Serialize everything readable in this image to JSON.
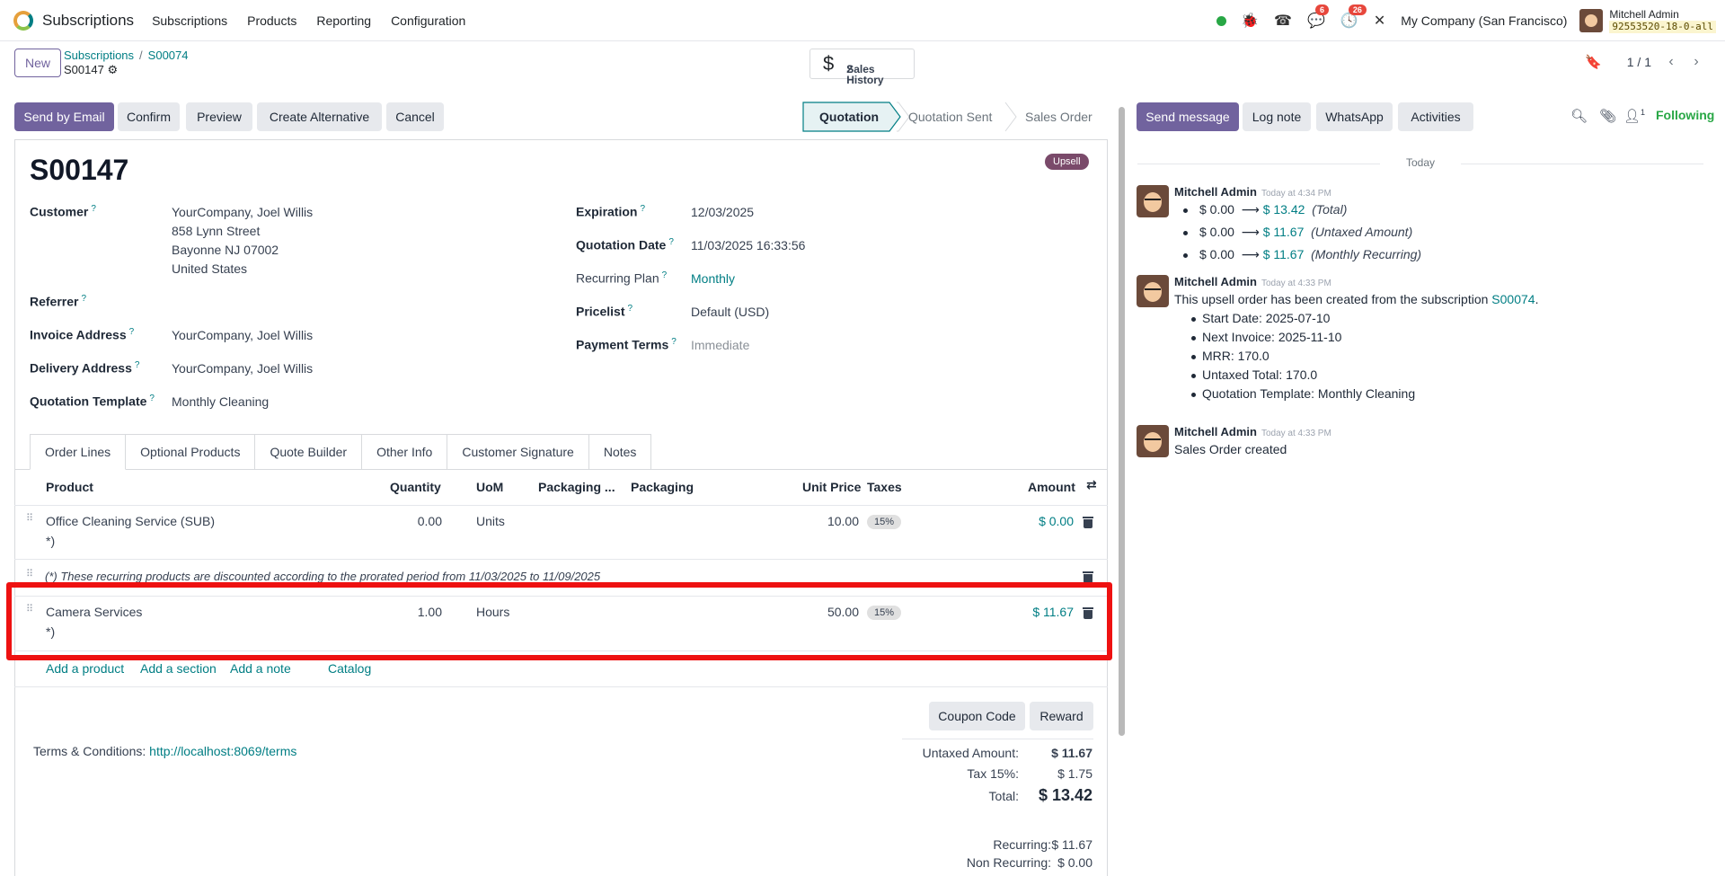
{
  "topnav": {
    "app_name": "Subscriptions",
    "menus": [
      "Subscriptions",
      "Products",
      "Reporting",
      "Configuration"
    ],
    "chat_count": "6",
    "activity_count": "26",
    "company": "My Company (San Francisco)",
    "user_name": "Mitchell Admin",
    "database": "92553520-18-0-all"
  },
  "control_panel": {
    "new_label": "New",
    "breadcrumb_root": "Subscriptions",
    "breadcrumb_parent": "S00074",
    "record_name": "S00147",
    "sales_history_label": "Sales History",
    "sales_history_count": "2",
    "pager": "1 / 1"
  },
  "actions": {
    "send_by_email": "Send by Email",
    "confirm": "Confirm",
    "preview": "Preview",
    "create_alternative": "Create Alternative",
    "cancel": "Cancel"
  },
  "statusbar": [
    "Quotation",
    "Quotation Sent",
    "Sales Order"
  ],
  "form": {
    "title": "S00147",
    "ribbon": "Upsell",
    "customer_label": "Customer",
    "customer_lines": [
      "YourCompany, Joel Willis",
      "858 Lynn Street",
      "Bayonne NJ 07002",
      "United States"
    ],
    "referrer_label": "Referrer",
    "invoice_address_label": "Invoice Address",
    "invoice_address": "YourCompany, Joel Willis",
    "delivery_address_label": "Delivery Address",
    "delivery_address": "YourCompany, Joel Willis",
    "quotation_template_label": "Quotation Template",
    "quotation_template": "Monthly Cleaning",
    "expiration_label": "Expiration",
    "expiration": "12/03/2025",
    "quotation_date_label": "Quotation Date",
    "quotation_date": "11/03/2025 16:33:56",
    "recurring_plan_label": "Recurring Plan",
    "recurring_plan": "Monthly",
    "pricelist_label": "Pricelist",
    "pricelist": "Default (USD)",
    "payment_terms_label": "Payment Terms",
    "payment_terms": "Immediate"
  },
  "tabs": [
    "Order Lines",
    "Optional Products",
    "Quote Builder",
    "Other Info",
    "Customer Signature",
    "Notes"
  ],
  "table": {
    "headers": {
      "product": "Product",
      "quantity": "Quantity",
      "uom": "UoM",
      "packaging_qty": "Packaging ...",
      "packaging": "Packaging",
      "unit_price": "Unit Price",
      "taxes": "Taxes",
      "amount": "Amount"
    },
    "rows": [
      {
        "product": "Office Cleaning Service (SUB)",
        "suffix": "*)",
        "quantity": "0.00",
        "uom": "Units",
        "unit_price": "10.00",
        "tax": "15%",
        "amount": "$ 0.00"
      },
      {
        "product": "Camera Services",
        "suffix": "*)",
        "quantity": "1.00",
        "uom": "Hours",
        "unit_price": "50.00",
        "tax": "15%",
        "amount": "$ 11.67"
      }
    ],
    "note": "(*) These recurring products are discounted according to the prorated period from 11/03/2025 to 11/09/2025",
    "add_product": "Add a product",
    "add_section": "Add a section",
    "add_note": "Add a note",
    "catalog": "Catalog"
  },
  "footer": {
    "coupon_code": "Coupon Code",
    "reward": "Reward",
    "terms_label": "Terms & Conditions:",
    "terms_link": "http://localhost:8069/terms",
    "untaxed_label": "Untaxed Amount:",
    "untaxed_value": "$ 11.67",
    "tax_label": "Tax 15%:",
    "tax_value": "$ 1.75",
    "total_label": "Total:",
    "total_value": "$ 13.42",
    "recurring_label": "Recurring:",
    "recurring_value": "$ 11.67",
    "non_recurring_label": "Non Recurring:",
    "non_recurring_value": "$ 0.00"
  },
  "chatter": {
    "send_message": "Send message",
    "log_note": "Log note",
    "whatsapp": "WhatsApp",
    "activities": "Activities",
    "followers_count": "1",
    "following": "Following",
    "today": "Today",
    "messages": [
      {
        "author": "Mitchell Admin",
        "time": "Today at 4:34 PM",
        "tracking": [
          {
            "old": "$ 0.00",
            "new": "$ 13.42",
            "field": "(Total)"
          },
          {
            "old": "$ 0.00",
            "new": "$ 11.67",
            "field": "(Untaxed Amount)"
          },
          {
            "old": "$ 0.00",
            "new": "$ 11.67",
            "field": "(Monthly Recurring)"
          }
        ]
      },
      {
        "author": "Mitchell Admin",
        "time": "Today at 4:33 PM",
        "body": "This upsell order has been created from the subscription",
        "link": "S00074",
        "bullets": [
          "Start Date: 2025-07-10",
          "Next Invoice: 2025-11-10",
          "MRR: 170.0",
          "Untaxed Total: 170.0",
          "Quotation Template: Monthly Cleaning"
        ]
      },
      {
        "author": "Mitchell Admin",
        "time": "Today at 4:33 PM",
        "body": "Sales Order created"
      }
    ]
  },
  "colors": {
    "primary": "#71639e",
    "link": "#017e84",
    "highlight": "#ee1111",
    "following": "#28a745"
  }
}
